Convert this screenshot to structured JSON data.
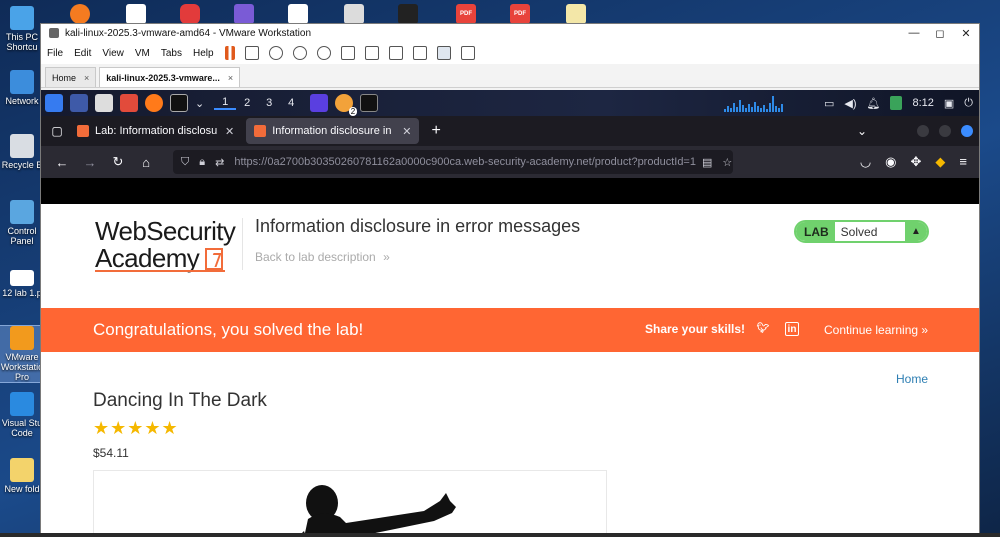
{
  "desktop": {
    "icons": [
      {
        "label": "This PC\nShortcu",
        "name": "this-pc"
      },
      {
        "label": "Network",
        "name": "network"
      },
      {
        "label": "Recycle B",
        "name": "recycle-bin"
      },
      {
        "label": "Control\nPanel",
        "name": "control-panel"
      },
      {
        "label": "12 lab 1.p",
        "name": "lab-file"
      },
      {
        "label": "VMware\nWorkstatio\nPro",
        "name": "vmware-workstation"
      },
      {
        "label": "Visual Stu\nCode",
        "name": "vscode"
      },
      {
        "label": "New fold",
        "name": "new-folder"
      }
    ]
  },
  "vmware": {
    "title": "kali-linux-2025.3-vmware-amd64 - VMware Workstation",
    "menu": [
      "File",
      "Edit",
      "View",
      "VM",
      "Tabs",
      "Help"
    ],
    "tabs": [
      {
        "label": "Home",
        "close": "×"
      },
      {
        "label": "kali-linux-2025.3-vmware...",
        "close": "×"
      }
    ],
    "win_buttons": [
      "—",
      "◻",
      "✕"
    ]
  },
  "kali": {
    "workspaces": [
      "1",
      "2",
      "3",
      "4"
    ],
    "clock": "8:12",
    "update_badge": "2"
  },
  "firefox": {
    "tabs": [
      {
        "label": "Lab: Information disclosure in error messages",
        "close": "✕"
      },
      {
        "label": "Information disclosure in error messages",
        "close": "✕"
      }
    ],
    "url_muted_prefix": "https://",
    "url_main": "0a2700b30350260781162a0000c900ca.web-security-academy.net",
    "url_suffix": "/product?productId=1"
  },
  "page": {
    "logo_line1": "WebSecurity",
    "logo_line2": "Academy",
    "lab_title": "Information disclosure in error messages",
    "back_link": "Back to lab description",
    "lab_label": "LAB",
    "lab_status": "Solved",
    "banner": {
      "congrats": "Congratulations, you solved the lab!",
      "share": "Share your skills!",
      "continue": "Continue learning"
    },
    "home_link": "Home",
    "product_name": "Dancing In The Dark",
    "rating": 5,
    "stars": "★★★★★",
    "price": "$54.11"
  },
  "colors": {
    "accent_orange": "#ff6633",
    "solved_green": "#70d16d",
    "firefox_dark": "#1c1b22",
    "link_blue": "#2e7fb3"
  }
}
